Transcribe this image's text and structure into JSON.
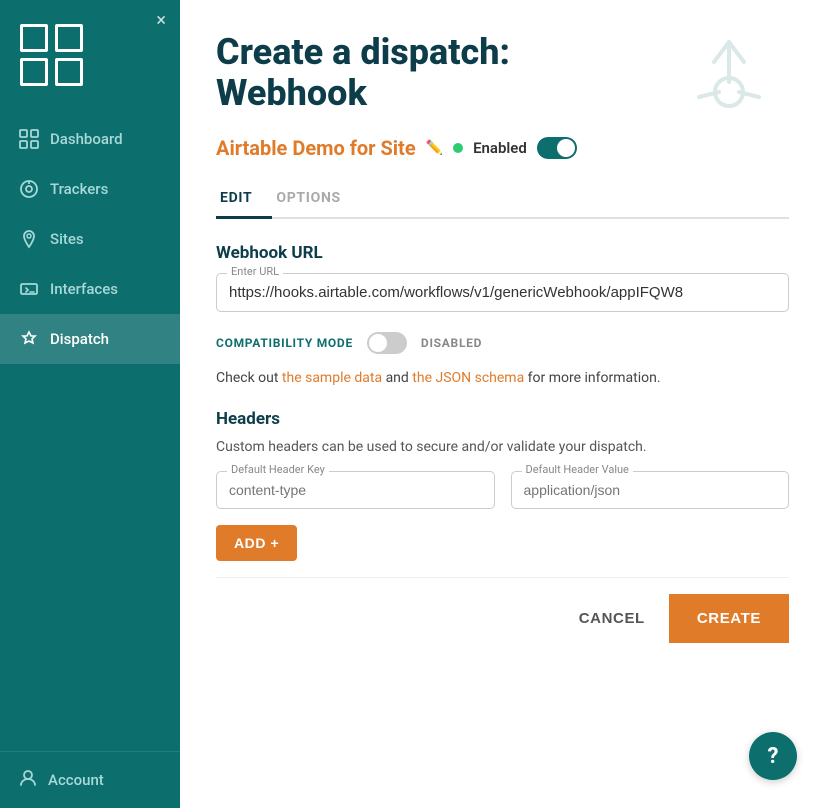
{
  "sidebar": {
    "close_label": "×",
    "nav_items": [
      {
        "id": "dashboard",
        "label": "Dashboard",
        "active": false
      },
      {
        "id": "trackers",
        "label": "Trackers",
        "active": false
      },
      {
        "id": "sites",
        "label": "Sites",
        "active": false
      },
      {
        "id": "interfaces",
        "label": "Interfaces",
        "active": false
      },
      {
        "id": "dispatch",
        "label": "Dispatch",
        "active": true
      }
    ],
    "account_label": "Account"
  },
  "header": {
    "title_line1": "Create a dispatch:",
    "title_line2": "Webhook",
    "subtitle": "Airtable Demo for Site",
    "enabled_label": "Enabled"
  },
  "tabs": [
    {
      "id": "edit",
      "label": "EDIT",
      "active": true
    },
    {
      "id": "options",
      "label": "OPTIONS",
      "active": false
    }
  ],
  "form": {
    "webhook_url_title": "Webhook URL",
    "url_field_label": "Enter URL",
    "url_value": "https://hooks.airtable.com/workflows/v1/genericWebhook/appIFQW8",
    "compat_mode_label": "COMPATIBILITY MODE",
    "compat_disabled_label": "DISABLED",
    "info_text_pre": "Check out ",
    "info_link1": "the sample data",
    "info_text_mid": " and ",
    "info_link2": "the JSON schema",
    "info_text_post": " for more information.",
    "headers_title": "Headers",
    "headers_desc": "Custom headers can be used to secure and/or validate your dispatch.",
    "header_key_label": "Default Header Key",
    "header_key_placeholder": "content-type",
    "header_value_label": "Default Header Value",
    "header_value_placeholder": "application/json",
    "add_btn_label": "ADD +"
  },
  "actions": {
    "cancel_label": "CANCEL",
    "create_label": "CREATE"
  },
  "help": {
    "label": "?"
  }
}
